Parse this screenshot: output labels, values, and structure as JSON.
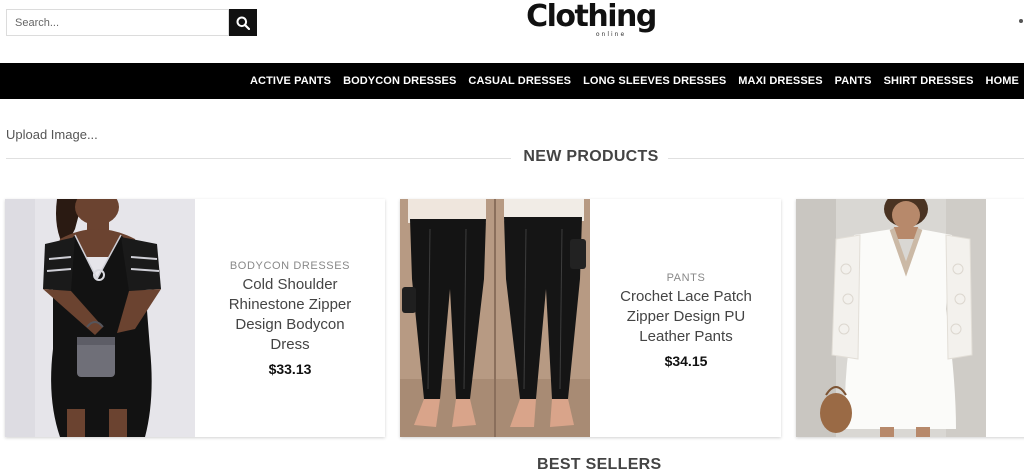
{
  "header": {
    "search_placeholder": "Search...",
    "logo_text": "Clothing",
    "logo_sub": "online"
  },
  "nav": {
    "items": [
      {
        "label": "ACTIVE PANTS"
      },
      {
        "label": "BODYCON DRESSES"
      },
      {
        "label": "CASUAL DRESSES"
      },
      {
        "label": "LONG SLEEVES DRESSES"
      },
      {
        "label": "MAXI DRESSES"
      },
      {
        "label": "PANTS"
      },
      {
        "label": "SHIRT DRESSES"
      },
      {
        "label": "HOME"
      }
    ]
  },
  "upload": {
    "label": "Upload Image..."
  },
  "sections": {
    "new_products": "NEW PRODUCTS",
    "best_sellers": "BEST SELLERS"
  },
  "products": [
    {
      "category": "BODYCON DRESSES",
      "name_lines": [
        "Cold Shoulder",
        "Rhinestone Zipper",
        "Design Bodycon",
        "Dress"
      ],
      "price": "$33.13"
    },
    {
      "category": "PANTS",
      "name_lines": [
        "Crochet Lace Patch",
        "Zipper Design PU",
        "Leather Pants"
      ],
      "price": "$34.15"
    },
    {
      "category": "",
      "name_lines": [],
      "price": ""
    }
  ],
  "icons": {
    "search": "search-icon"
  },
  "colors": {
    "nav_bg": "#000000",
    "search_btn": "#111111",
    "accent_text": "#444444"
  }
}
